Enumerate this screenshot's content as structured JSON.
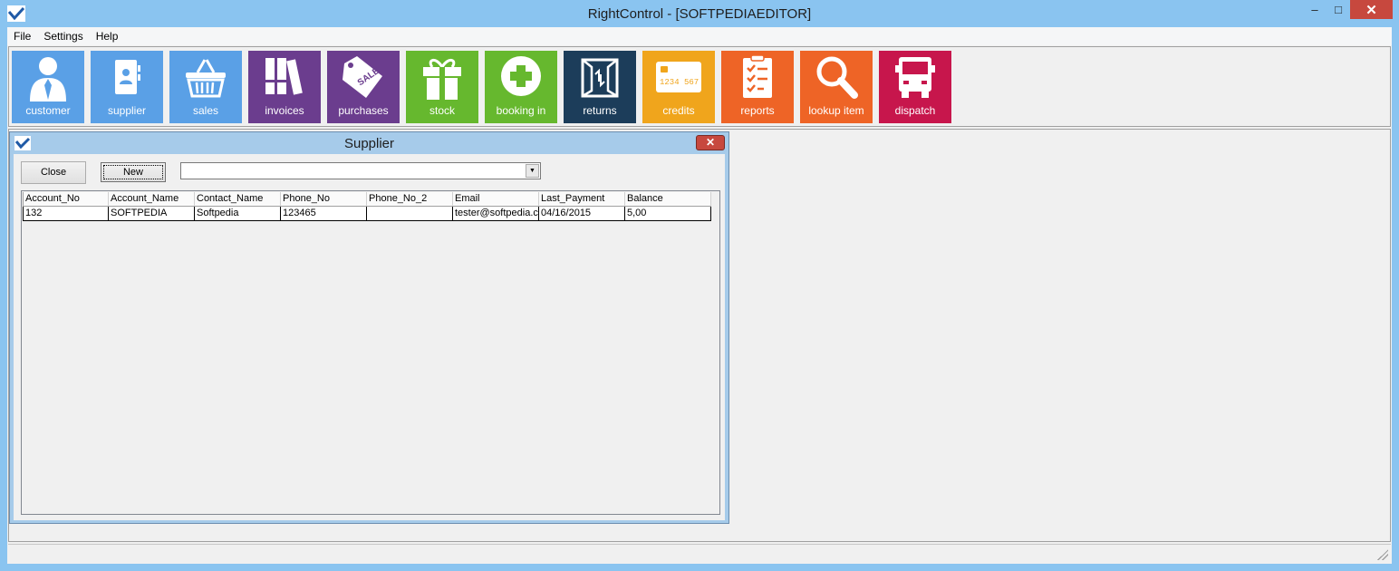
{
  "window": {
    "title": "RightControl - [SOFTPEDIAEDITOR]",
    "min_icon": "minimize-icon",
    "max_icon": "maximize-icon",
    "close_icon": "close-icon"
  },
  "menu": [
    "File",
    "Settings",
    "Help"
  ],
  "toolbar": [
    {
      "label": "customer",
      "icon": "person-icon",
      "color": "#5aa0e6"
    },
    {
      "label": "supplier",
      "icon": "contacts-book-icon",
      "color": "#5aa0e6"
    },
    {
      "label": "sales",
      "icon": "basket-icon",
      "color": "#5aa0e6"
    },
    {
      "label": "invoices",
      "icon": "binders-icon",
      "color": "#6b3d8e"
    },
    {
      "label": "purchases",
      "icon": "sale-tag-icon",
      "color": "#6b3d8e"
    },
    {
      "label": "stock",
      "icon": "gift-icon",
      "color": "#66b82e"
    },
    {
      "label": "booking in",
      "icon": "plus-circle-icon",
      "color": "#66b82e"
    },
    {
      "label": "returns",
      "icon": "box-icon",
      "color": "#1c3d5a"
    },
    {
      "label": "credits",
      "icon": "credit-card-icon",
      "color": "#f0a51c"
    },
    {
      "label": "reports",
      "icon": "checklist-icon",
      "color": "#ee6426"
    },
    {
      "label": "lookup item",
      "icon": "magnifier-icon",
      "color": "#ee6426"
    },
    {
      "label": "dispatch",
      "icon": "truck-icon",
      "color": "#c7164c"
    }
  ],
  "supplier_window": {
    "title": "Supplier",
    "close_label": "Close",
    "new_label": "New",
    "filter_value": "",
    "columns": [
      "Account_No",
      "Account_Name",
      "Contact_Name",
      "Phone_No",
      "Phone_No_2",
      "Email",
      "Last_Payment",
      "Balance"
    ],
    "rows": [
      [
        "132",
        "SOFTPEDIA",
        "Softpedia",
        "123465",
        "",
        "tester@softpedia.com",
        "04/16/2015",
        "5,00"
      ]
    ]
  }
}
